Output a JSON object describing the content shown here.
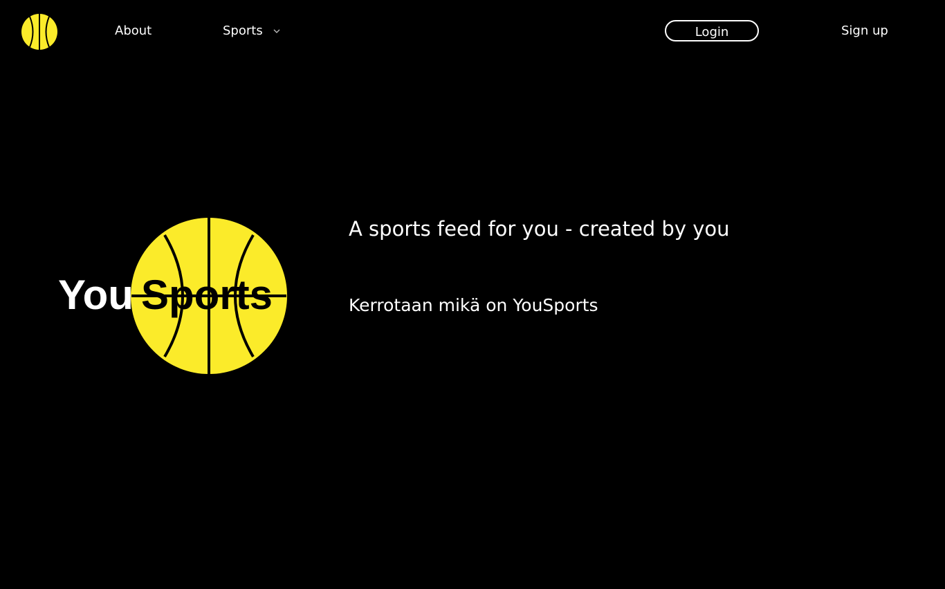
{
  "colors": {
    "background": "#000000",
    "text": "#ffffff",
    "brand_yellow": "#fbeb2a"
  },
  "nav": {
    "logo_icon": "basketball-icon",
    "about_label": "About",
    "sports_label": "Sports",
    "sports_dropdown_icon": "chevron-down-icon",
    "login_label": "Login",
    "signup_label": "Sign up"
  },
  "hero": {
    "logo_text": "YouSports",
    "title": "A sports feed for you - created by you",
    "subtitle": "Kerrotaan mikä on YouSports"
  }
}
